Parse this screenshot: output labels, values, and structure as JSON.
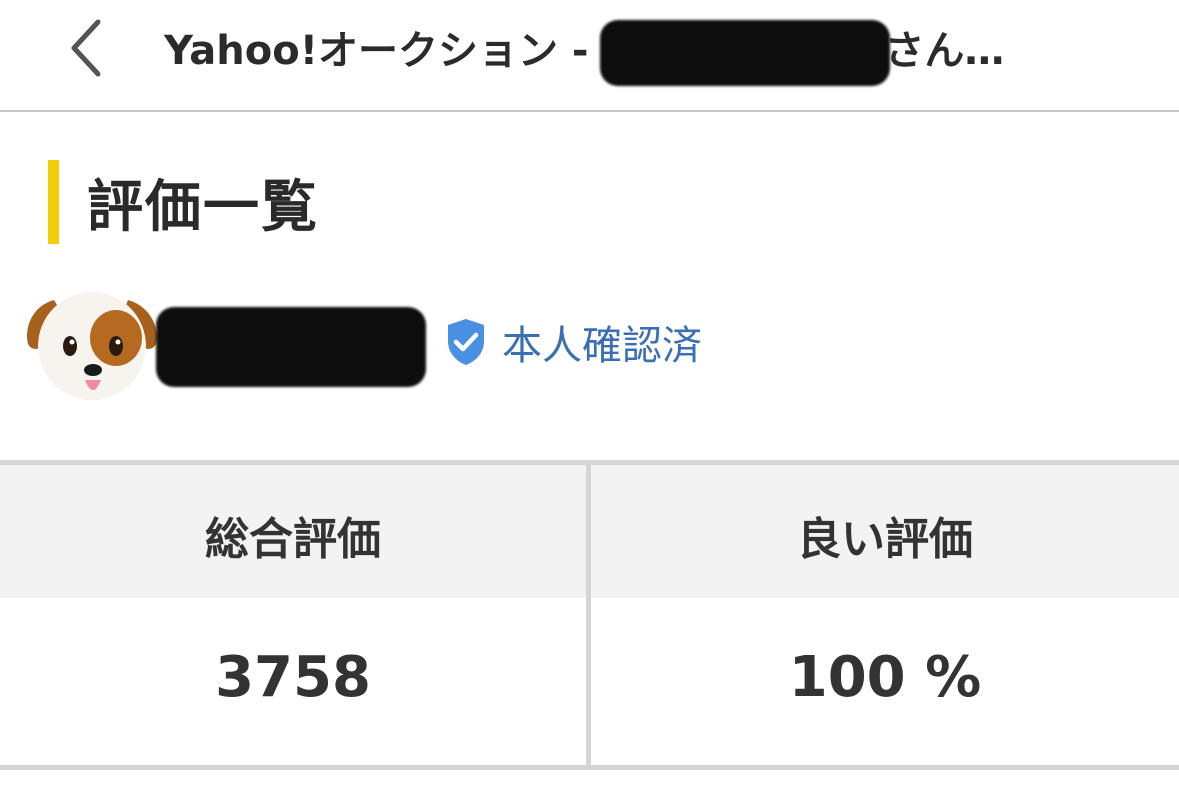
{
  "navbar": {
    "title_prefix": "Yahoo!オークション - ",
    "title_suffix": "さん…"
  },
  "section": {
    "title": "評価一覧"
  },
  "user": {
    "verified_label": "本人確認済"
  },
  "stats": {
    "total_label": "総合評価",
    "total_value": "3758",
    "good_label": "良い評価",
    "good_value": "100 %"
  },
  "colors": {
    "accent": "#f4cd0a",
    "verified": "#3a6fb4",
    "shield": "#4a90e2"
  },
  "icons": {
    "back": "chevron-left-icon",
    "verified": "shield-check-icon",
    "avatar": "dog-face-avatar"
  }
}
